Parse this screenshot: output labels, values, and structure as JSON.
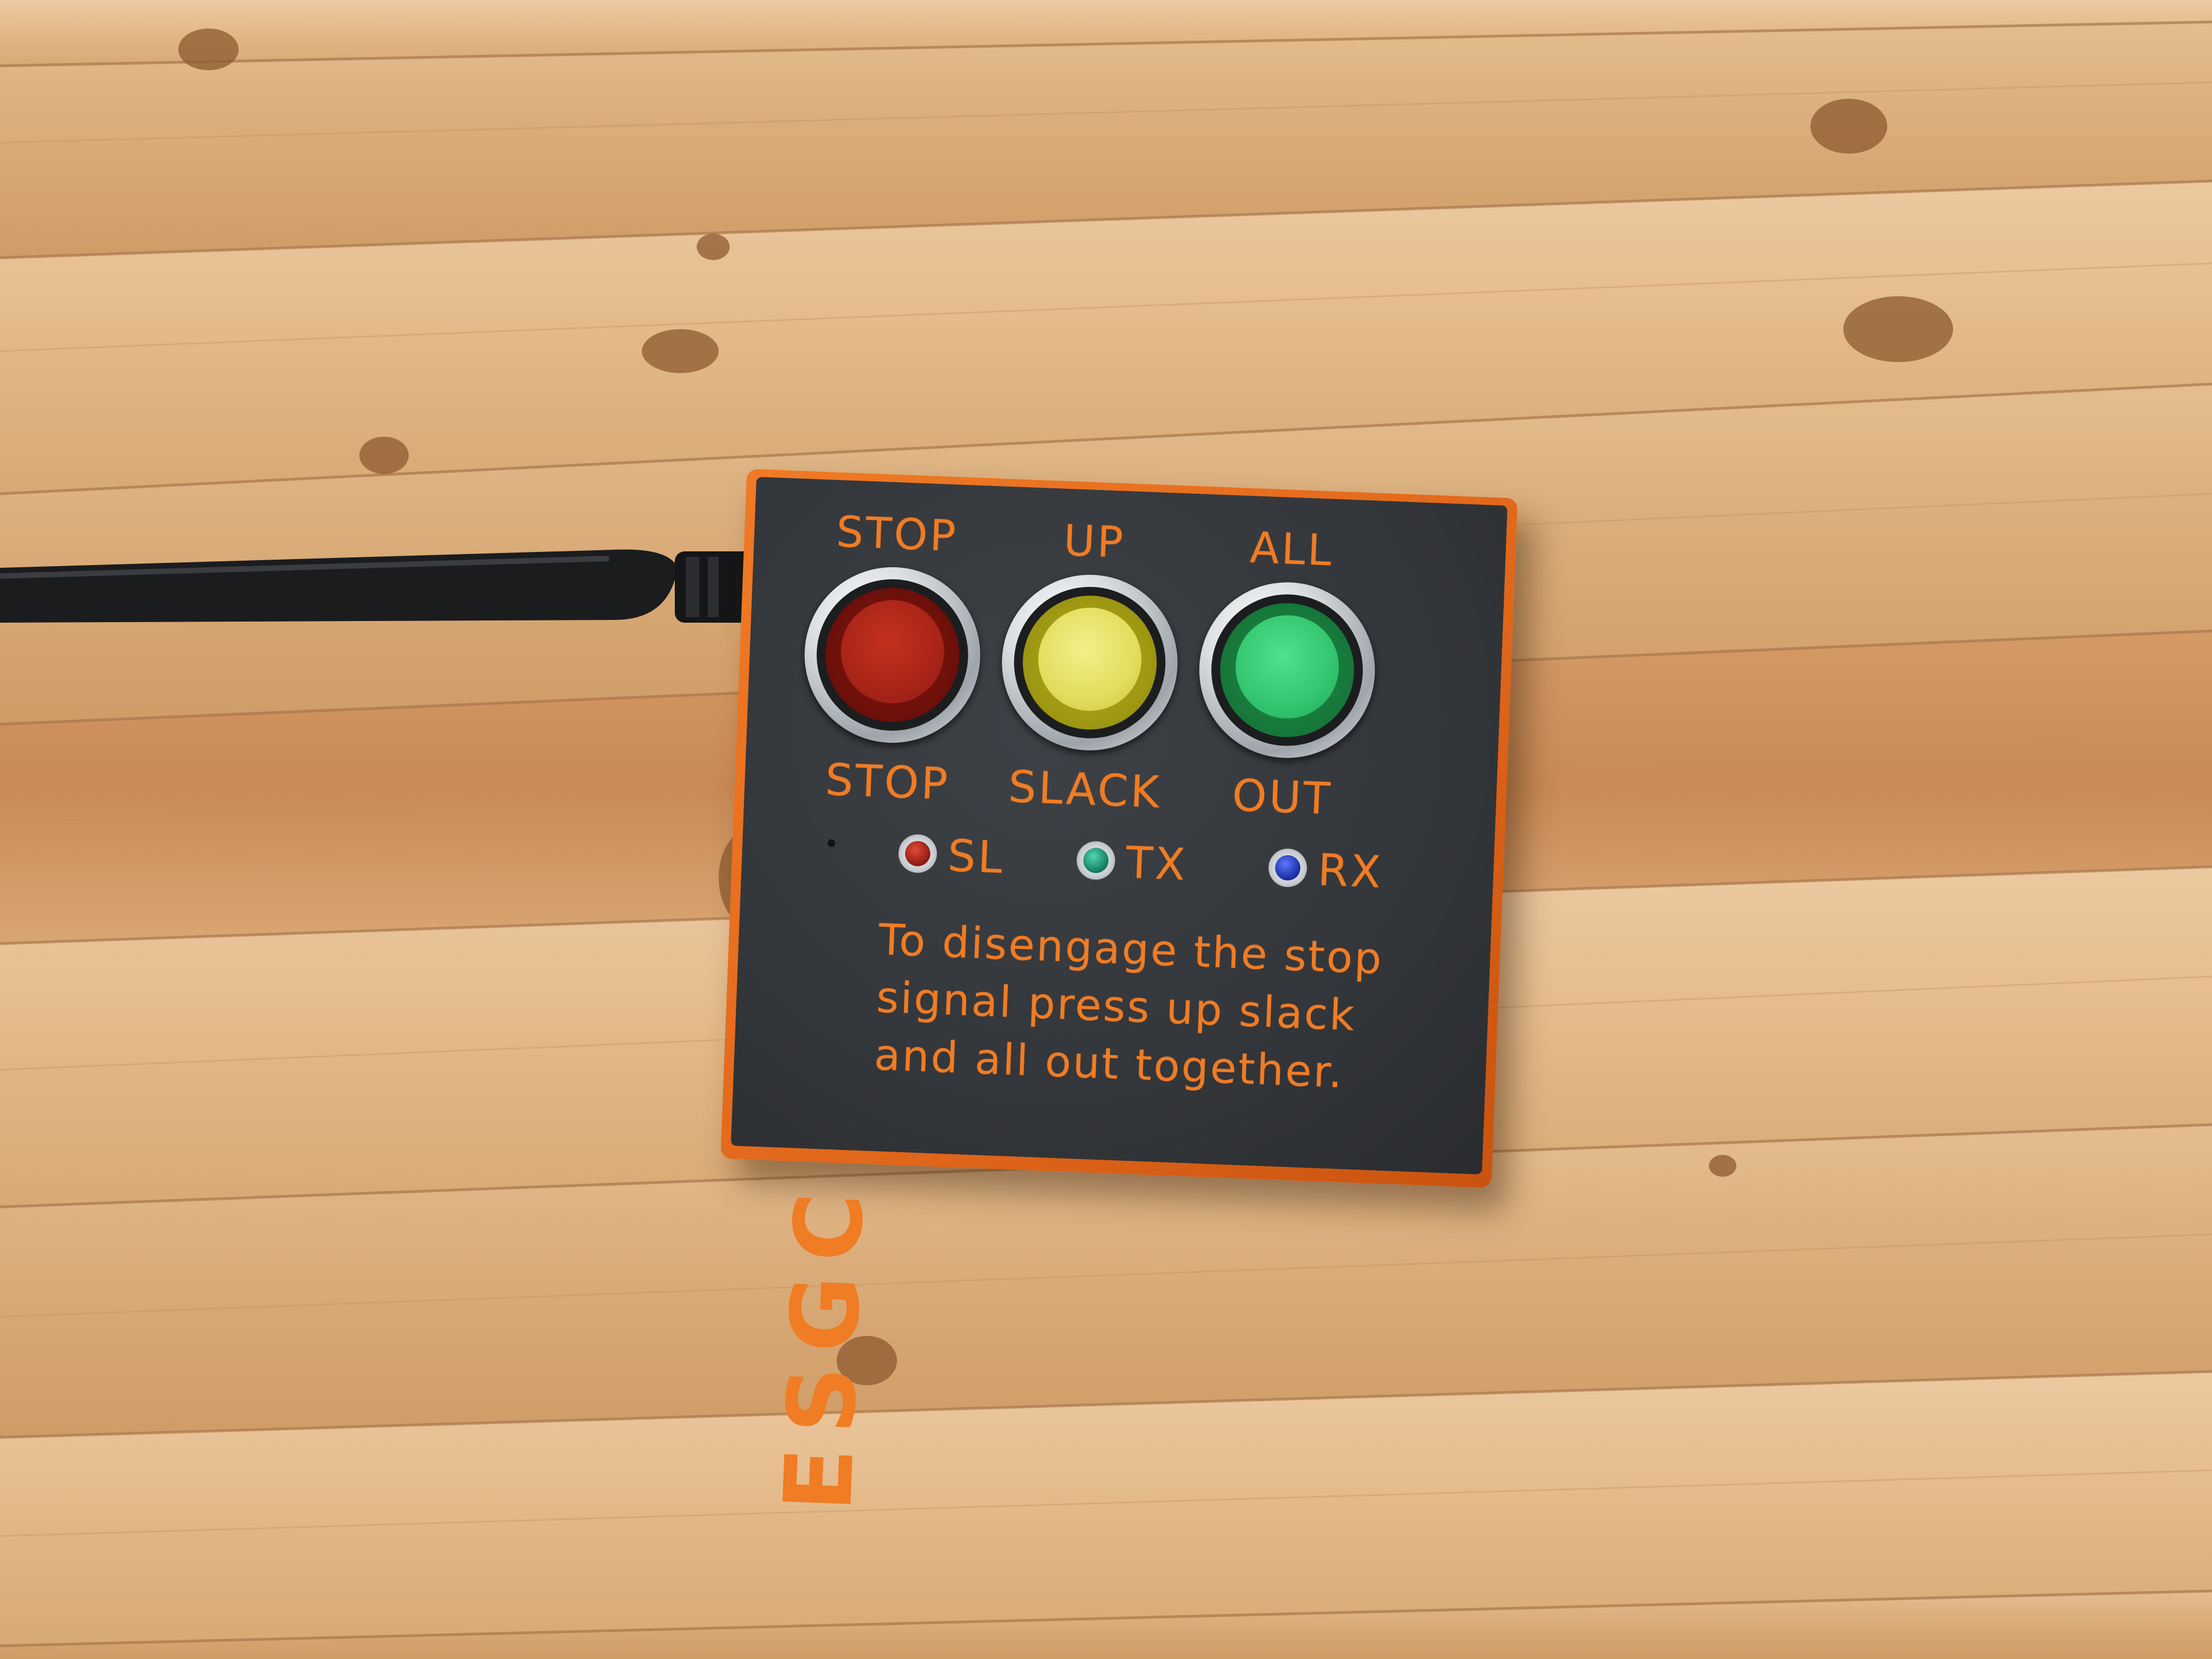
{
  "device": {
    "buttons": [
      {
        "label": "STOP"
      },
      {
        "label": "UP"
      },
      {
        "label": "ALL"
      }
    ],
    "button_labels": [
      {
        "label": "STOP"
      },
      {
        "label": "SLACK"
      },
      {
        "label": "OUT"
      }
    ],
    "leds": [
      {
        "label": "SL"
      },
      {
        "label": "TX"
      },
      {
        "label": "RX"
      }
    ],
    "brand": "ESGC",
    "instructions": [
      "To disengage the stop",
      "signal press up slack",
      "and all out together."
    ]
  },
  "colors": {
    "enclosure_edge": "#f07a25",
    "panel": "#33363a",
    "engraving": "#f07c24",
    "button_stop": "#a82418",
    "button_up": "#e2dd5d",
    "button_all": "#33c56f",
    "led_sl": "#8f1a10",
    "led_tx": "#127a5e",
    "led_rx": "#1a2aa0",
    "wood": "#dcae7c"
  }
}
